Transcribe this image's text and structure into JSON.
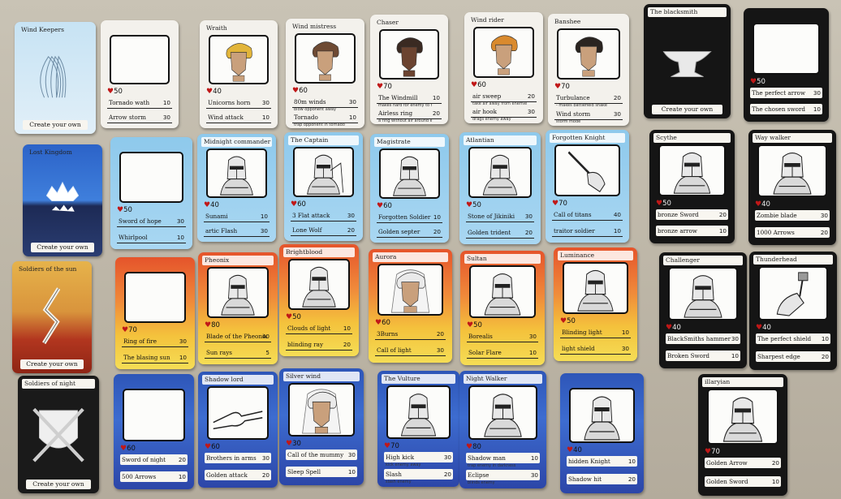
{
  "cards": [
    {
      "id": "wind-keepers",
      "name": "Wind Keepers",
      "theme": "wind",
      "kind": "emblem",
      "emblem": "wind-swirl",
      "create": "Create your own"
    },
    {
      "id": "blank-white",
      "name": "",
      "theme": "white",
      "kind": "character",
      "hp": "50",
      "moves": [
        {
          "name": "Tornado wath",
          "power": "10"
        },
        {
          "name": "Arrow storm",
          "power": "30"
        }
      ]
    },
    {
      "id": "wraith",
      "name": "Wraith",
      "theme": "white",
      "kind": "character",
      "portrait": "face-blond",
      "hp": "40",
      "moves": [
        {
          "name": "Unicorns horn",
          "power": "30"
        },
        {
          "name": "Wind attack",
          "power": "10"
        }
      ]
    },
    {
      "id": "wind-mistress",
      "name": "Wind mistress",
      "theme": "white",
      "kind": "character",
      "portrait": "face-brown",
      "hp": "60",
      "moves": [
        {
          "name": "80m winds",
          "sub": "blow opponent away",
          "power": "30"
        },
        {
          "name": "Tornado",
          "sub": "trap opponent in tornado",
          "power": "10"
        }
      ]
    },
    {
      "id": "chaser",
      "name": "Chaser",
      "theme": "white",
      "kind": "character",
      "portrait": "face-dark",
      "hp": "70",
      "moves": [
        {
          "name": "The Windmill",
          "sub": "makes hard for enemy to fight",
          "power": "10"
        },
        {
          "name": "Airless ring",
          "sub": "a ring without air around enemy",
          "power": "20"
        }
      ]
    },
    {
      "id": "wind-rider",
      "name": "Wind rider",
      "theme": "white",
      "kind": "character",
      "portrait": "face-orange",
      "hp": "60",
      "moves": [
        {
          "name": "air sweep",
          "sub": "take air away from enemies",
          "power": "20"
        },
        {
          "name": "air hook",
          "sub": "drags enemy away",
          "power": "30"
        }
      ]
    },
    {
      "id": "banshee",
      "name": "Banshee",
      "theme": "white",
      "kind": "character",
      "portrait": "face-curly",
      "hp": "70",
      "moves": [
        {
          "name": "Turbulance",
          "sub": "- makes battlefield shake",
          "power": "20"
        },
        {
          "name": "Wind storm",
          "sub": "storm mode",
          "power": "30"
        }
      ]
    },
    {
      "id": "blacksmith",
      "name": "The blacksmith",
      "theme": "black",
      "kind": "emblem",
      "emblem": "anvil",
      "create": "Create your own"
    },
    {
      "id": "blank-black",
      "name": "",
      "theme": "black",
      "kind": "character",
      "hp": "50",
      "moves": [
        {
          "name": "The perfect arrow",
          "power": "30"
        },
        {
          "name": "The chosen sword",
          "power": "10"
        }
      ]
    },
    {
      "id": "lost-kingdom",
      "name": "Lost Kingdom",
      "theme": "kingdom",
      "kind": "emblem",
      "emblem": "crown",
      "create": "Create your own"
    },
    {
      "id": "blank-lblue",
      "name": "",
      "theme": "lblue",
      "kind": "character",
      "hp": "50",
      "moves": [
        {
          "name": "Sword of hope",
          "power": "30"
        },
        {
          "name": "Whirlpool",
          "power": "10"
        }
      ]
    },
    {
      "id": "midnight-commander",
      "name": "Midnight commander",
      "theme": "lblue",
      "kind": "character",
      "portrait": "helmet",
      "hp": "40",
      "moves": [
        {
          "name": "Sunami",
          "power": "10"
        },
        {
          "name": "artic Flash",
          "power": "30"
        }
      ]
    },
    {
      "id": "the-captain",
      "name": "The Captain",
      "theme": "lblue",
      "kind": "character",
      "portrait": "armor",
      "hp": "60",
      "moves": [
        {
          "name": "3 Flat attack",
          "power": "30"
        },
        {
          "name": "Lone Wolf",
          "power": "20"
        }
      ]
    },
    {
      "id": "magistrate",
      "name": "Magistrate",
      "theme": "lblue",
      "kind": "character",
      "portrait": "helmet",
      "hp": "60",
      "moves": [
        {
          "name": "Forgotten Soldier",
          "power": "10"
        },
        {
          "name": "Golden septer",
          "power": "20"
        }
      ]
    },
    {
      "id": "atlantian",
      "name": "Atlantian",
      "theme": "lblue",
      "kind": "character",
      "portrait": "helmet",
      "hp": "50",
      "moves": [
        {
          "name": "Stone of Jikiniki",
          "power": "30"
        },
        {
          "name": "Golden trident",
          "power": "20"
        }
      ]
    },
    {
      "id": "forgotten-knight",
      "name": "Forgotten Knight",
      "theme": "lblue",
      "kind": "character",
      "portrait": "sword-arm",
      "hp": "70",
      "moves": [
        {
          "name": "Call of titans",
          "power": "40"
        },
        {
          "name": "traitor soldier",
          "power": "10"
        }
      ]
    },
    {
      "id": "scythe",
      "name": "Scythe",
      "theme": "black",
      "kind": "character",
      "portrait": "helmet",
      "hp": "50",
      "moves": [
        {
          "name": "bronze Sword",
          "power": "20"
        },
        {
          "name": "bronze arrow",
          "power": "10"
        }
      ]
    },
    {
      "id": "way-walker",
      "name": "Way walker",
      "theme": "black",
      "kind": "character",
      "portrait": "helmet",
      "hp": "40",
      "moves": [
        {
          "name": "Zombie blade",
          "power": "30"
        },
        {
          "name": "1000 Arrows",
          "power": "20"
        }
      ]
    },
    {
      "id": "soldiers-of-the-sun",
      "name": "Soldiers of the sun",
      "theme": "sun",
      "kind": "emblem",
      "emblem": "sun-sword",
      "create": "Create your own"
    },
    {
      "id": "blank-fire",
      "name": "",
      "theme": "fire",
      "kind": "character",
      "hp": "70",
      "moves": [
        {
          "name": "Ring of fire",
          "power": "30"
        },
        {
          "name": "The blasing sun",
          "power": "10"
        }
      ]
    },
    {
      "id": "pheonix",
      "name": "Pheonix",
      "theme": "fire",
      "kind": "character",
      "portrait": "helmet",
      "hp": "80",
      "moves": [
        {
          "name": "Blade of the Pheonix",
          "power": "40"
        },
        {
          "name": "Sun rays",
          "power": "5"
        }
      ]
    },
    {
      "id": "bright-blood",
      "name": "Brightblood",
      "theme": "fire",
      "kind": "character",
      "portrait": "helmet",
      "hp": "50",
      "moves": [
        {
          "name": "Clouds of light",
          "power": "10"
        },
        {
          "name": "blinding ray",
          "power": "20"
        }
      ]
    },
    {
      "id": "aurora",
      "name": "Aurora",
      "theme": "fire",
      "kind": "character",
      "portrait": "face-long",
      "hp": "60",
      "moves": [
        {
          "name": "3Burns",
          "power": "20"
        },
        {
          "name": "Call of light",
          "power": "30"
        }
      ]
    },
    {
      "id": "sultan",
      "name": "Sultan",
      "theme": "fire",
      "kind": "character",
      "portrait": "helmet",
      "hp": "50",
      "moves": [
        {
          "name": "Borealis",
          "power": "30"
        },
        {
          "name": "Solar Flare",
          "power": "10"
        }
      ]
    },
    {
      "id": "luminance",
      "name": "Luminance",
      "theme": "fire",
      "kind": "character",
      "portrait": "helmet",
      "hp": "50",
      "moves": [
        {
          "name": "Blinding light",
          "power": "10"
        },
        {
          "name": "light shield",
          "power": "30"
        }
      ]
    },
    {
      "id": "challenger",
      "name": "Challenger",
      "theme": "black",
      "kind": "character",
      "portrait": "helmet",
      "hp": "40",
      "moves": [
        {
          "name": "BlackSmiths hammer",
          "power": "30"
        },
        {
          "name": "Broken Sword",
          "power": "10"
        }
      ]
    },
    {
      "id": "thunderhead",
      "name": "Thunderhead",
      "theme": "black",
      "kind": "character",
      "portrait": "hammer-arm",
      "hp": "40",
      "moves": [
        {
          "name": "The perfect shield",
          "power": "10"
        },
        {
          "name": "Sharpest edge",
          "power": "20"
        }
      ]
    },
    {
      "id": "soldiers-of-night",
      "name": "Soldiers of night",
      "theme": "night",
      "kind": "emblem",
      "emblem": "shield-swords",
      "create": "Create your own"
    },
    {
      "id": "blank-dblue",
      "name": "",
      "theme": "dblue",
      "kind": "character",
      "hp": "60",
      "moves": [
        {
          "name": "Sword of night",
          "power": "20"
        },
        {
          "name": "500 Arrows",
          "power": "10"
        }
      ]
    },
    {
      "id": "shadow-lord",
      "name": "Shadow lord",
      "theme": "dblue",
      "kind": "character",
      "portrait": "handshake",
      "hp": "60",
      "moves": [
        {
          "name": "Brothers in arms",
          "power": "30"
        },
        {
          "name": "Golden attack",
          "power": "20"
        }
      ]
    },
    {
      "id": "silver-wind",
      "name": "Silver wind",
      "theme": "dblue",
      "kind": "character",
      "portrait": "face-long",
      "hp": "30",
      "moves": [
        {
          "name": "Call of the mummy",
          "power": "30"
        },
        {
          "name": "Sleep Spell",
          "power": "10"
        }
      ]
    },
    {
      "id": "the-vulture",
      "name": "The Vulture",
      "theme": "dblue",
      "kind": "character",
      "portrait": "helmet",
      "hp": "70",
      "moves": [
        {
          "name": "High kick",
          "sub": "kick enemy away",
          "power": "30"
        },
        {
          "name": "Slash",
          "sub": "slash enemy",
          "power": "20"
        }
      ]
    },
    {
      "id": "night-walker",
      "name": "Night Walker",
      "theme": "dblue",
      "kind": "character",
      "portrait": "helmet",
      "hp": "80",
      "moves": [
        {
          "name": "Shadow man",
          "sub": "trap enemy in darkness",
          "power": "10"
        },
        {
          "name": "Eclipse",
          "sub": "blinds enemy",
          "power": "30"
        }
      ]
    },
    {
      "id": "dblue-knight",
      "name": "",
      "theme": "dblue",
      "kind": "character",
      "portrait": "helmet",
      "hp": "40",
      "moves": [
        {
          "name": "hidden Knight",
          "power": "10"
        },
        {
          "name": "Shadow hit",
          "power": "20"
        }
      ]
    },
    {
      "id": "illaryian",
      "name": "illaryian",
      "theme": "black",
      "kind": "character",
      "portrait": "helmet",
      "hp": "70",
      "moves": [
        {
          "name": "Golden Arrow",
          "power": "20"
        },
        {
          "name": "Golden Sword",
          "power": "10"
        }
      ]
    }
  ]
}
